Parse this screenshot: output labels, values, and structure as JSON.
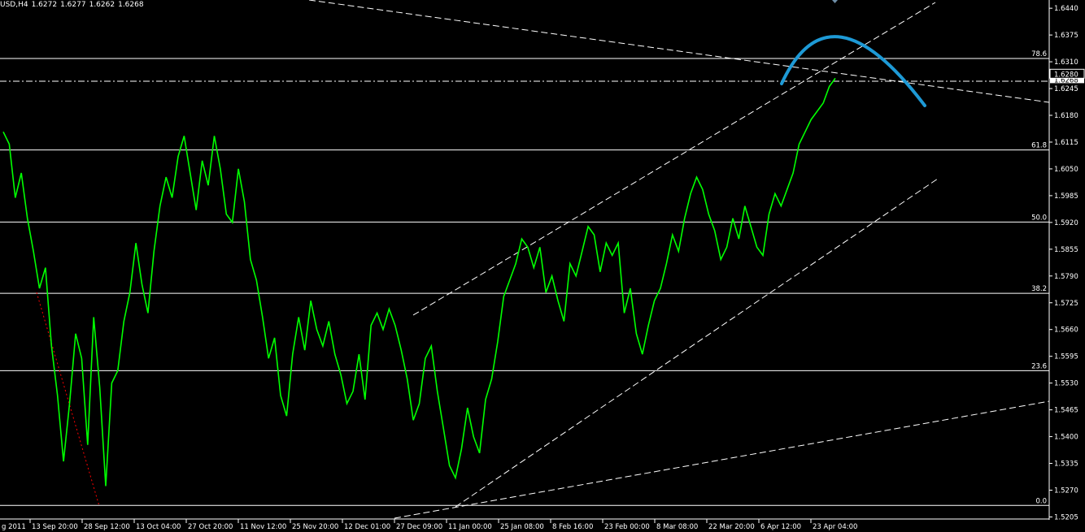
{
  "header": {
    "symbol": "USD,H4",
    "open": "1.6272",
    "high": "1.6277",
    "low": "1.6262",
    "close": "1.6268"
  },
  "colors": {
    "background": "#000000",
    "price": "#00ff00",
    "lines": "#ffffff",
    "forecast": "#1e9ad6",
    "red_line": "#ff0000"
  },
  "current_price": {
    "label": "1.6280",
    "value": 1.628,
    "partial_label": "1.6268",
    "partial_value": 1.6268
  },
  "fib_levels": [
    {
      "label": "78.6",
      "value": 1.6318
    },
    {
      "label": "61.8",
      "value": 1.6096
    },
    {
      "label": "50.0",
      "value": 1.5921
    },
    {
      "label": "38.2",
      "value": 1.5748
    },
    {
      "label": "23.6",
      "value": 1.556
    },
    {
      "label": "0.0",
      "value": 1.5233
    }
  ],
  "chart_data": {
    "type": "line",
    "title": "",
    "series": [
      {
        "name": "",
        "values": [
          1.614,
          1.611,
          1.598,
          1.604,
          1.593,
          1.585,
          1.576,
          1.581,
          1.562,
          1.55,
          1.534,
          1.548,
          1.565,
          1.559,
          1.538,
          1.569,
          1.552,
          1.528,
          1.553,
          1.556,
          1.568,
          1.575,
          1.587,
          1.577,
          1.57,
          1.585,
          1.596,
          1.603,
          1.598,
          1.608,
          1.613,
          1.604,
          1.595,
          1.607,
          1.601,
          1.613,
          1.605,
          1.594,
          1.592,
          1.605,
          1.597,
          1.583,
          1.578,
          1.569,
          1.559,
          1.564,
          1.55,
          1.545,
          1.56,
          1.569,
          1.561,
          1.573,
          1.566,
          1.562,
          1.568,
          1.56,
          1.555,
          1.548,
          1.551,
          1.56,
          1.549,
          1.567,
          1.57,
          1.566,
          1.571,
          1.567,
          1.561,
          1.554,
          1.544,
          1.548,
          1.559,
          1.562,
          1.551,
          1.542,
          1.533,
          1.53,
          1.537,
          1.547,
          1.54,
          1.536,
          1.549,
          1.554,
          1.563,
          1.574,
          1.578,
          1.582,
          1.588,
          1.586,
          1.581,
          1.586,
          1.575,
          1.579,
          1.573,
          1.568,
          1.582,
          1.579,
          1.585,
          1.591,
          1.589,
          1.58,
          1.587,
          1.584,
          1.587,
          1.57,
          1.576,
          1.565,
          1.56,
          1.567,
          1.573,
          1.576,
          1.582,
          1.589,
          1.585,
          1.593,
          1.599,
          1.603,
          1.6,
          1.594,
          1.59,
          1.583,
          1.586,
          1.593,
          1.588,
          1.596,
          1.591,
          1.586,
          1.584,
          1.594,
          1.599,
          1.596,
          1.6,
          1.604,
          1.611,
          1.614,
          1.617,
          1.619,
          1.621,
          1.625,
          1.627
        ]
      }
    ],
    "x_tick_labels": [
      "g 2011",
      "13 Sep 20:00",
      "28 Sep 12:00",
      "13 Oct 04:00",
      "27 Oct 20:00",
      "11 Nov 12:00",
      "25 Nov 20:00",
      "12 Dec 01:00",
      "27 Dec 09:00",
      "11 Jan 00:00",
      "25 Jan 08:00",
      "8 Feb 16:00",
      "23 Feb 00:00",
      "8 Mar 08:00",
      "22 Mar 20:00",
      "6 Apr 12:00",
      "23 Apr 04:00"
    ],
    "y_tick_labels": [
      "1.6440",
      "1.6375",
      "1.6310",
      "1.6245",
      "1.6180",
      "1.6115",
      "1.6050",
      "1.5985",
      "1.5920",
      "1.5855",
      "1.5790",
      "1.5725",
      "1.5660",
      "1.5595",
      "1.5530",
      "1.5465",
      "1.5400",
      "1.5335",
      "1.5270",
      "1.5205"
    ],
    "ylim": [
      1.52,
      1.646
    ],
    "grid": false
  }
}
